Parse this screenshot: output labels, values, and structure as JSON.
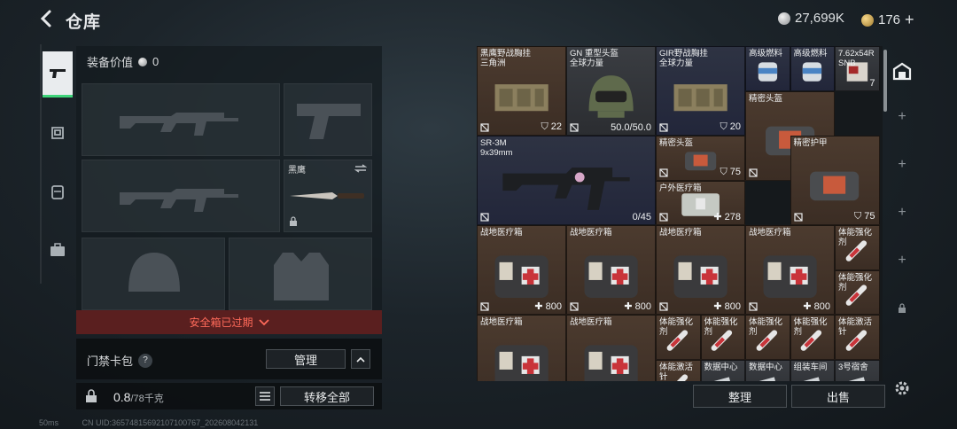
{
  "header": {
    "title": "仓库",
    "silver": "27,699K",
    "gold": "176",
    "gold_plus": "+"
  },
  "left": {
    "equip_value_label": "装备价值",
    "equip_value": "0",
    "knife_name": "黑鹰",
    "expired_text": "安全箱已过期",
    "keycard_label": "门禁卡包",
    "help": "?",
    "manage_button": "管理",
    "capacity_used": "0.8",
    "capacity_total": "/78千克",
    "transfer_all": "转移全部"
  },
  "inventory": {
    "items": [
      {
        "name": "黑鹰野战胸挂\n三角洲",
        "value": "22",
        "color": "brown"
      },
      {
        "name": "GN 重型头盔\n全球力量",
        "value": "50.0/50.0",
        "color": "grey"
      },
      {
        "name": "GIR野战胸挂\n全球力量",
        "value": "20",
        "color": "blue"
      },
      {
        "name": "高级燃料",
        "value": "",
        "color": "blue"
      },
      {
        "name": "高级燃料",
        "value": "",
        "color": "blue"
      },
      {
        "name": "7.62x54R\nSNB",
        "value": "7",
        "color": "grey"
      },
      {
        "name": "精密头盔",
        "value": "75",
        "color": "brown"
      },
      {
        "name": "SR-3M\n9x39mm",
        "value": "0/45",
        "color": "blue"
      },
      {
        "name": "精密头盔",
        "value": "75",
        "color": "brown"
      },
      {
        "name": "精密护甲",
        "value": "75",
        "color": "brown"
      },
      {
        "name": "户外医疗箱",
        "value": "278",
        "color": "brown"
      },
      {
        "name": "战地医疗箱",
        "value": "800",
        "color": "brown"
      },
      {
        "name": "战地医疗箱",
        "value": "800",
        "color": "brown"
      },
      {
        "name": "战地医疗箱",
        "value": "800",
        "color": "brown"
      },
      {
        "name": "战地医疗箱",
        "value": "800",
        "color": "brown"
      },
      {
        "name": "体能强化剂",
        "value": "",
        "color": "brown"
      },
      {
        "name": "体能强化剂",
        "value": "",
        "color": "brown"
      },
      {
        "name": "战地医疗箱",
        "value": "",
        "color": "brown"
      },
      {
        "name": "战地医疗箱",
        "value": "",
        "color": "brown"
      },
      {
        "name": "体能强化剂",
        "value": "",
        "color": "brown"
      },
      {
        "name": "体能强化剂",
        "value": "",
        "color": "brown"
      },
      {
        "name": "体能强化剂",
        "value": "",
        "color": "brown"
      },
      {
        "name": "体能强化剂",
        "value": "",
        "color": "brown"
      },
      {
        "name": "体能激活针",
        "value": "",
        "color": "brown"
      },
      {
        "name": "体能激活针",
        "value": "",
        "color": "brown"
      },
      {
        "name": "数据中心",
        "value": "",
        "color": "grey"
      },
      {
        "name": "数据中心",
        "value": "",
        "color": "grey"
      },
      {
        "name": "组装车间",
        "value": "",
        "color": "grey"
      },
      {
        "name": "3号宿舍",
        "value": "",
        "color": "grey"
      }
    ],
    "sort_button": "整理",
    "sell_button": "出售"
  },
  "footer": {
    "ping": "50ms",
    "uid": "CN UID:365748156921071​00767_202608042131"
  },
  "colors": {
    "accent_green": "#3fd47a",
    "expired_red": "#ff6a5a",
    "medkit_red": "#c9343a"
  }
}
